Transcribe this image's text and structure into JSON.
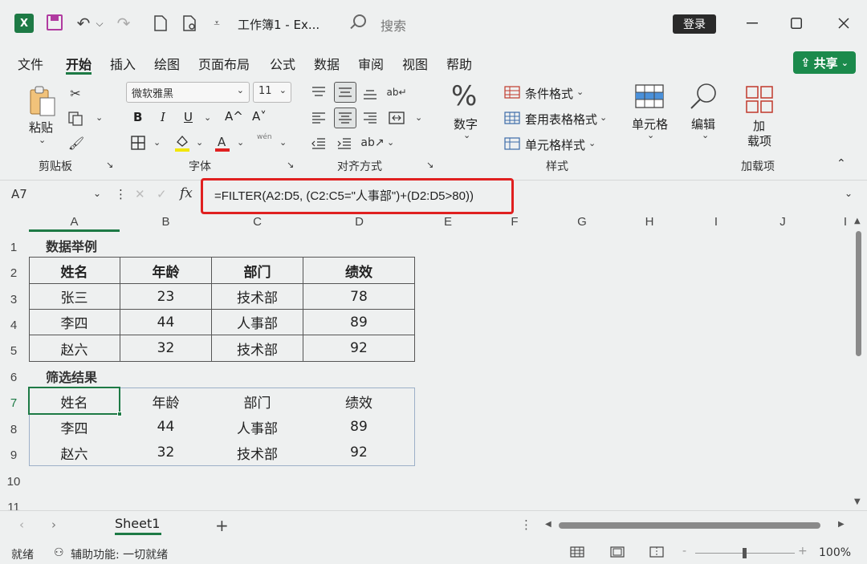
{
  "titlebar": {
    "app_icon": "excel-icon",
    "undo_caret": "⌵",
    "title": "工作簿1  -  Ex...",
    "search_placeholder": "搜索",
    "login": "登录"
  },
  "menu": {
    "items": [
      "文件",
      "开始",
      "插入",
      "绘图",
      "页面布局",
      "公式",
      "数据",
      "审阅",
      "视图",
      "帮助"
    ],
    "share": "共享"
  },
  "ribbon": {
    "paste_label": "粘贴",
    "clipboard_group": "剪贴板",
    "font_name": "微软雅黑",
    "font_size": "11",
    "bold": "B",
    "italic": "I",
    "underline": "U",
    "grow_font": "A^",
    "shrink_font": "A˅",
    "wen": "wén",
    "font_group": "字体",
    "align_group": "对齐方式",
    "number_label": "数字",
    "cond_format": "条件格式",
    "table_format": "套用表格格式",
    "cell_styles": "单元格样式",
    "styles_group": "样式",
    "cells_label": "单元格",
    "edit_label": "编辑",
    "addin_label_1": "加",
    "addin_label_2": "载项",
    "addin_group": "加载项"
  },
  "formula_bar": {
    "namebox": "A7",
    "fx": "fx",
    "formula": "=FILTER(A2:D5, (C2:C5=\"人事部\")+(D2:D5>80))"
  },
  "grid": {
    "columns": [
      "A",
      "B",
      "C",
      "D",
      "E",
      "F",
      "G",
      "H",
      "I",
      "J",
      "I"
    ],
    "rows": [
      "1",
      "2",
      "3",
      "4",
      "5",
      "6",
      "7",
      "8",
      "9",
      "10",
      "11"
    ],
    "section1_title": "数据举例",
    "section2_title": "筛选结果",
    "headers": [
      "姓名",
      "年龄",
      "部门",
      "绩效"
    ],
    "data_rows": [
      [
        "张三",
        "23",
        "技术部",
        "78"
      ],
      [
        "李四",
        "44",
        "人事部",
        "89"
      ],
      [
        "赵六",
        "32",
        "技术部",
        "92"
      ]
    ],
    "result_rows": [
      [
        "李四",
        "44",
        "人事部",
        "89"
      ],
      [
        "赵六",
        "32",
        "技术部",
        "92"
      ]
    ]
  },
  "bottom": {
    "sheet_tab": "Sheet1",
    "add_sheet": "+",
    "status_ready": "就绪",
    "accessibility": "辅助功能: 一切就绪",
    "zoom": "100%",
    "zoom_minus": "-",
    "zoom_plus": "+"
  },
  "colors": {
    "accent": "#1d7a45",
    "highlight": "#e02020",
    "share": "#1b8a4c"
  }
}
